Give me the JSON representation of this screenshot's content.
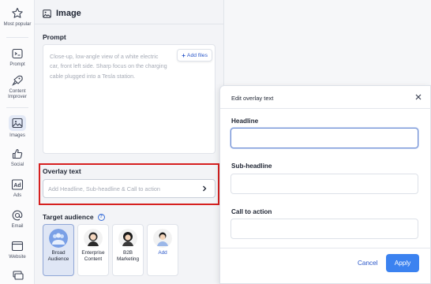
{
  "sidebar": {
    "items": [
      {
        "label": "Most popular",
        "icon": "star-icon"
      },
      {
        "label": "Prompt",
        "icon": "prompt-icon"
      },
      {
        "label": "Content Improver",
        "icon": "rocket-icon"
      },
      {
        "label": "Images",
        "icon": "image-icon",
        "active": true
      },
      {
        "label": "Social",
        "icon": "thumbs-up-icon"
      },
      {
        "label": "Ads",
        "icon": "ad-icon"
      },
      {
        "label": "Email",
        "icon": "at-icon"
      },
      {
        "label": "Website",
        "icon": "browser-icon"
      }
    ]
  },
  "panel": {
    "title": "Image",
    "prompt_label": "Prompt",
    "prompt_text": "Close-up, low-angle view of a white electric car, front left side. Sharp focus on the charging cable plugged into a Tesla station.",
    "add_files": "Add files",
    "overlay_label": "Overlay text",
    "overlay_placeholder": "Add Headline, Sub-headline & Call to action",
    "audience_label": "Target audience",
    "audiences": [
      {
        "line1": "Broad",
        "line2": "Audience",
        "selected": true
      },
      {
        "line1": "Enterprise",
        "line2": "Content"
      },
      {
        "line1": "B2B",
        "line2": "Marketing"
      },
      {
        "line1": "Add",
        "line2": ""
      }
    ]
  },
  "dialog": {
    "title": "Edit overlay text",
    "headline_label": "Headline",
    "subheadline_label": "Sub-headline",
    "cta_label": "Call to action",
    "cancel": "Cancel",
    "apply": "Apply"
  },
  "colors": {
    "accent": "#3b82f0",
    "highlight": "#d62020",
    "link": "#2a57c9"
  }
}
